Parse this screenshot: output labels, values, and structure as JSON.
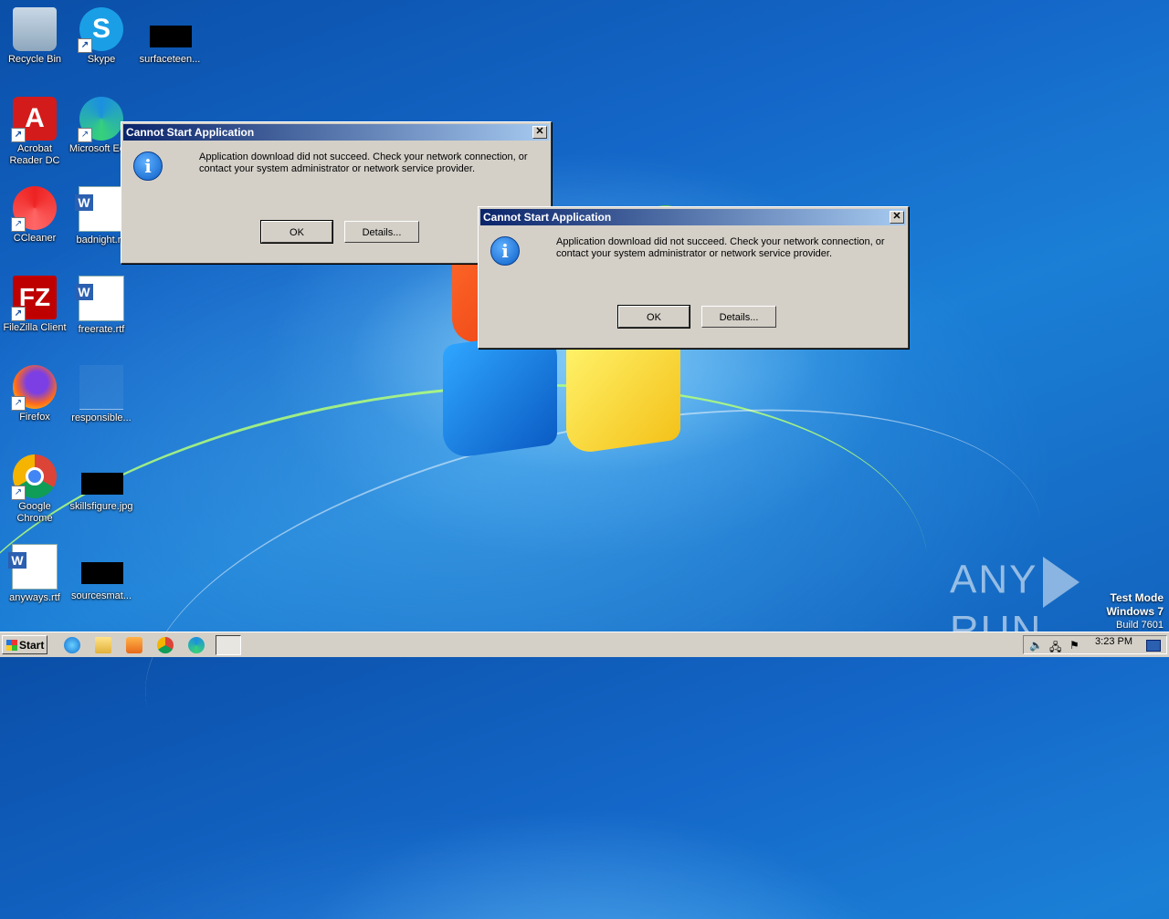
{
  "desktop_icons": [
    {
      "label": "Recycle Bin",
      "icon": "recycle-bin-icon"
    },
    {
      "label": "Skype",
      "icon": "skype-icon"
    },
    {
      "label": "surfaceteen...",
      "icon": "redacted-file-icon"
    },
    {
      "label": "Acrobat\nReader DC",
      "icon": "acrobat-icon"
    },
    {
      "label": "Microsoft Ed...",
      "icon": "edge-icon"
    },
    {
      "label": "CCleaner",
      "icon": "ccleaner-icon"
    },
    {
      "label": "badnight.rtf",
      "icon": "word-doc-icon"
    },
    {
      "label": "FileZilla Client",
      "icon": "filezilla-icon"
    },
    {
      "label": "freerate.rtf",
      "icon": "word-doc-icon"
    },
    {
      "label": "Firefox",
      "icon": "firefox-icon"
    },
    {
      "label": "responsible...",
      "icon": "blank-file-icon"
    },
    {
      "label": "Google\nChrome",
      "icon": "chrome-icon"
    },
    {
      "label": "skillsfigure.jpg",
      "icon": "redacted-file-icon"
    },
    {
      "label": "anyways.rtf",
      "icon": "word-doc-icon"
    },
    {
      "label": "sourcesmat...",
      "icon": "redacted-file-icon"
    }
  ],
  "dialogs": [
    {
      "title": "Cannot Start Application",
      "message": "Application download did not succeed. Check your network connection, or contact your system administrator or network service provider.",
      "ok_label": "OK",
      "details_label": "Details...",
      "close_glyph": "✕"
    },
    {
      "title": "Cannot Start Application",
      "message": "Application download did not succeed. Check your network connection, or contact your system administrator or network service provider.",
      "ok_label": "OK",
      "details_label": "Details...",
      "close_glyph": "✕"
    }
  ],
  "watermark": {
    "left": "ANY",
    "right": "RUN"
  },
  "system_info": {
    "line1": "Test Mode",
    "line2": "Windows 7",
    "line3": "Build 7601"
  },
  "taskbar": {
    "start_label": "Start",
    "clock": "3:23 PM",
    "pinned": [
      "internet-explorer-icon",
      "explorer-icon",
      "media-player-icon",
      "chrome-icon",
      "edge-icon",
      "app-window-icon"
    ]
  }
}
